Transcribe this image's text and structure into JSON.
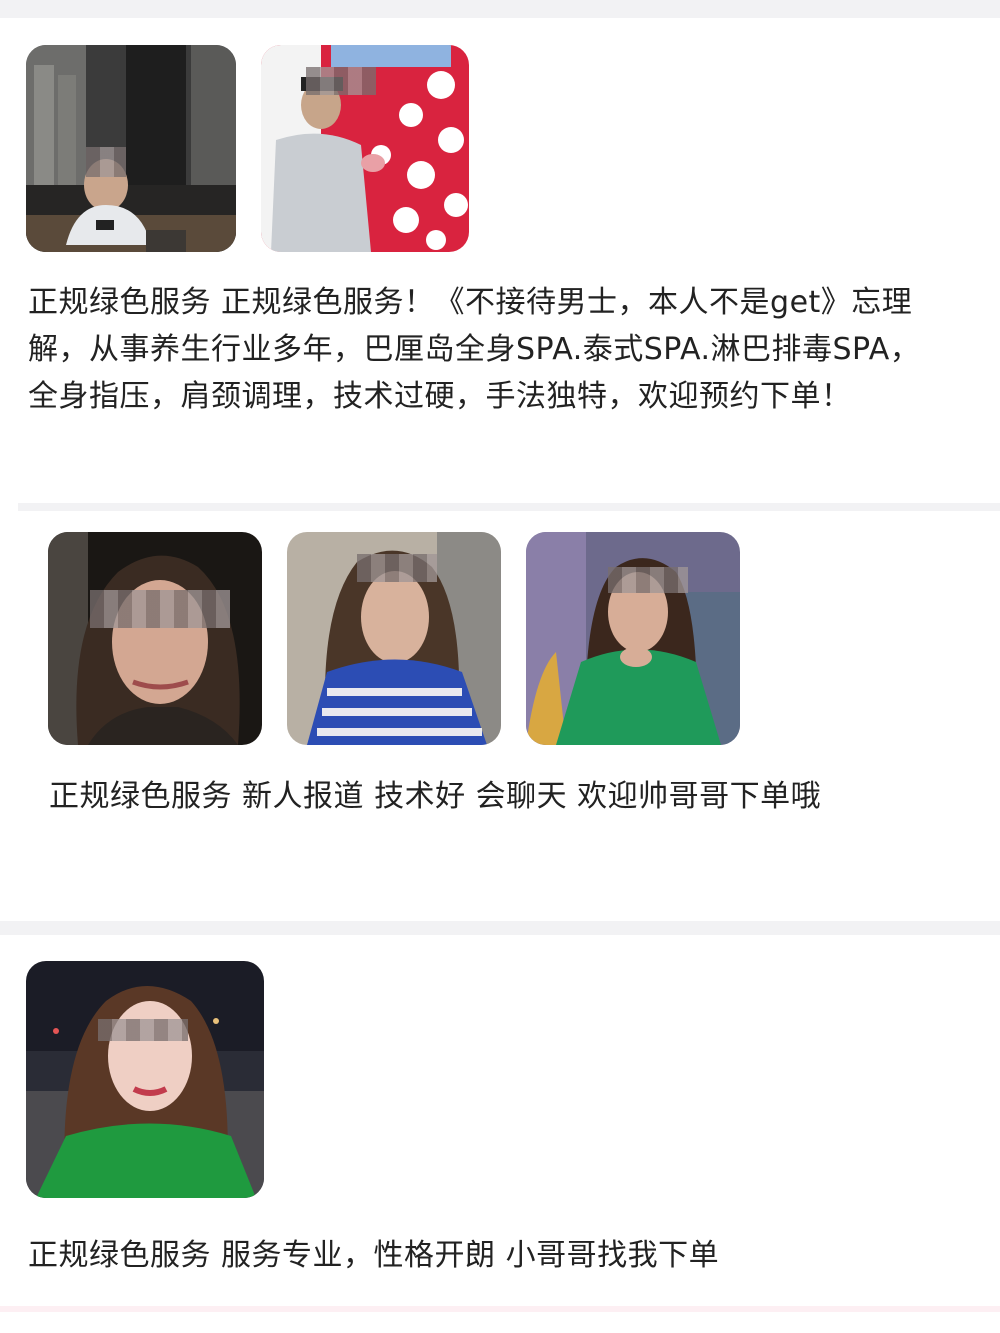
{
  "posts": [
    {
      "text": "正规绿色服务 正规绿色服务！《不接待男士，本人不是get》忘理解，从事养生行业多年，巴厘岛全身SPA.泰式SPA.淋巴排毒SPA，全身指压，肩颈调理，技术过硬，手法独特，欢迎预约下单！",
      "photos": [
        "photo-man-seated-phone",
        "photo-man-birthday-polka-dot"
      ]
    },
    {
      "text": "正规绿色服务 新人报道 技术好 会聊天 欢迎帅哥哥下单哦",
      "photos": [
        "photo-woman-selfie-dark",
        "photo-woman-blue-sweater",
        "photo-woman-green-sweater"
      ]
    },
    {
      "text": "正规绿色服务 服务专业，性格开朗 小哥哥找我下单",
      "photos": [
        "photo-woman-green-top-night"
      ]
    }
  ]
}
